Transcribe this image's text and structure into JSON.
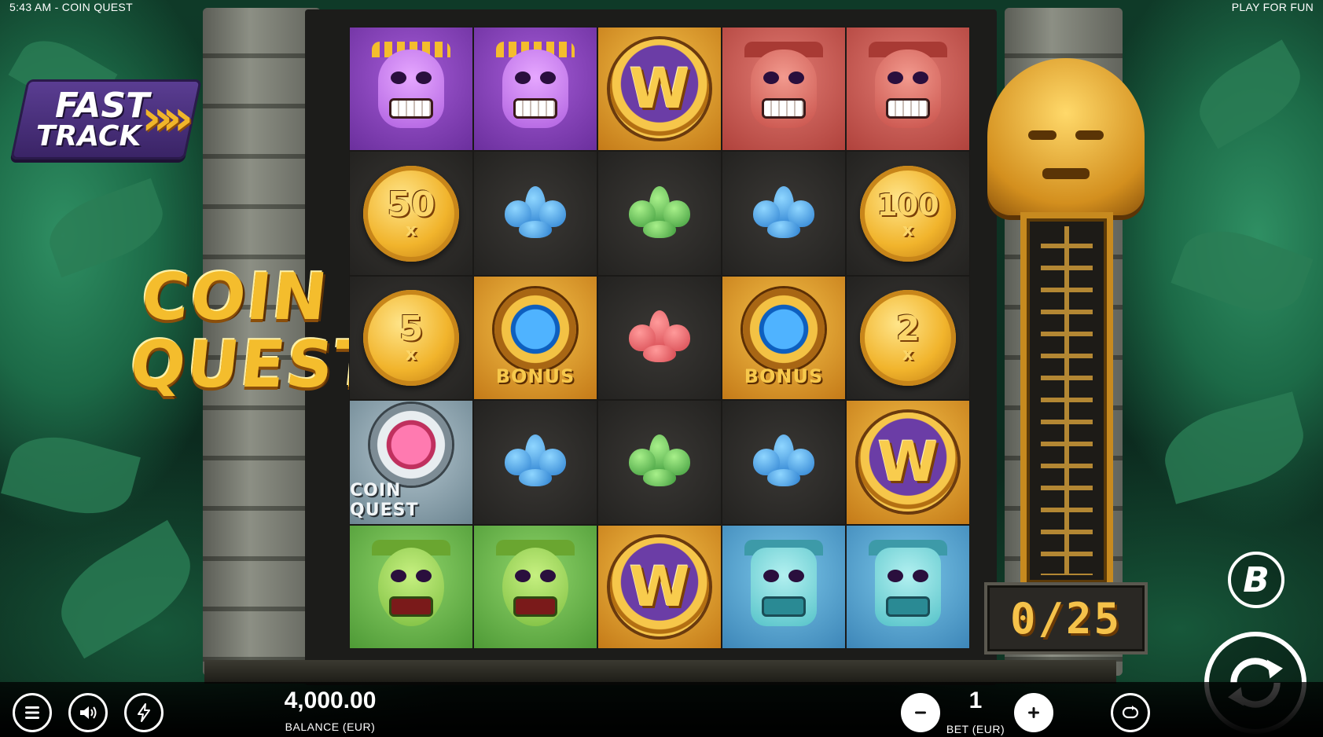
{
  "status": {
    "time": "5:43 AM",
    "game_title": "COIN QUEST",
    "title_line": "5:43 AM - COIN QUEST",
    "mode": "PLAY FOR FUN"
  },
  "fast_track": {
    "line1": "FAST",
    "line2": "TRACK"
  },
  "logo": {
    "line1": "COIN",
    "line2": "QUEST"
  },
  "reels": {
    "rows": [
      [
        {
          "symbol": "skull-mask",
          "bg": "purple"
        },
        {
          "symbol": "skull-mask",
          "bg": "purple"
        },
        {
          "symbol": "wild",
          "label": "W",
          "bg": "gold"
        },
        {
          "symbol": "jaguar-mask",
          "bg": "red"
        },
        {
          "symbol": "jaguar-mask",
          "bg": "red"
        }
      ],
      [
        {
          "symbol": "coin",
          "value": "50",
          "mult": "x"
        },
        {
          "symbol": "blue-gem"
        },
        {
          "symbol": "green-gem"
        },
        {
          "symbol": "blue-gem"
        },
        {
          "symbol": "coin",
          "value": "100",
          "mult": "x"
        }
      ],
      [
        {
          "symbol": "coin",
          "value": "5",
          "mult": "x"
        },
        {
          "symbol": "bonus",
          "label": "BONUS",
          "bg": "gold"
        },
        {
          "symbol": "red-gem"
        },
        {
          "symbol": "bonus",
          "label": "BONUS",
          "bg": "gold"
        },
        {
          "symbol": "coin",
          "value": "2",
          "mult": "x"
        }
      ],
      [
        {
          "symbol": "coin-quest-scatter",
          "label": "COIN QUEST",
          "bg": "silver"
        },
        {
          "symbol": "blue-gem"
        },
        {
          "symbol": "green-gem"
        },
        {
          "symbol": "blue-gem"
        },
        {
          "symbol": "wild",
          "label": "W",
          "bg": "gold"
        }
      ],
      [
        {
          "symbol": "monkey-mask",
          "bg": "green"
        },
        {
          "symbol": "monkey-mask",
          "bg": "green"
        },
        {
          "symbol": "wild",
          "label": "W",
          "bg": "gold"
        },
        {
          "symbol": "serpent-mask",
          "bg": "blue"
        },
        {
          "symbol": "serpent-mask",
          "bg": "blue"
        }
      ]
    ]
  },
  "collector": {
    "value": "0/25"
  },
  "brand": {
    "letter": "B"
  },
  "footer": {
    "balance_value": "4,000.00",
    "balance_label": "BALANCE (EUR)",
    "bet_value": "1",
    "bet_label": "BET (EUR)",
    "icons": [
      "menu-icon",
      "sound-icon",
      "turbo-icon",
      "minus-icon",
      "plus-icon",
      "autoplay-icon",
      "spin-icon"
    ]
  }
}
